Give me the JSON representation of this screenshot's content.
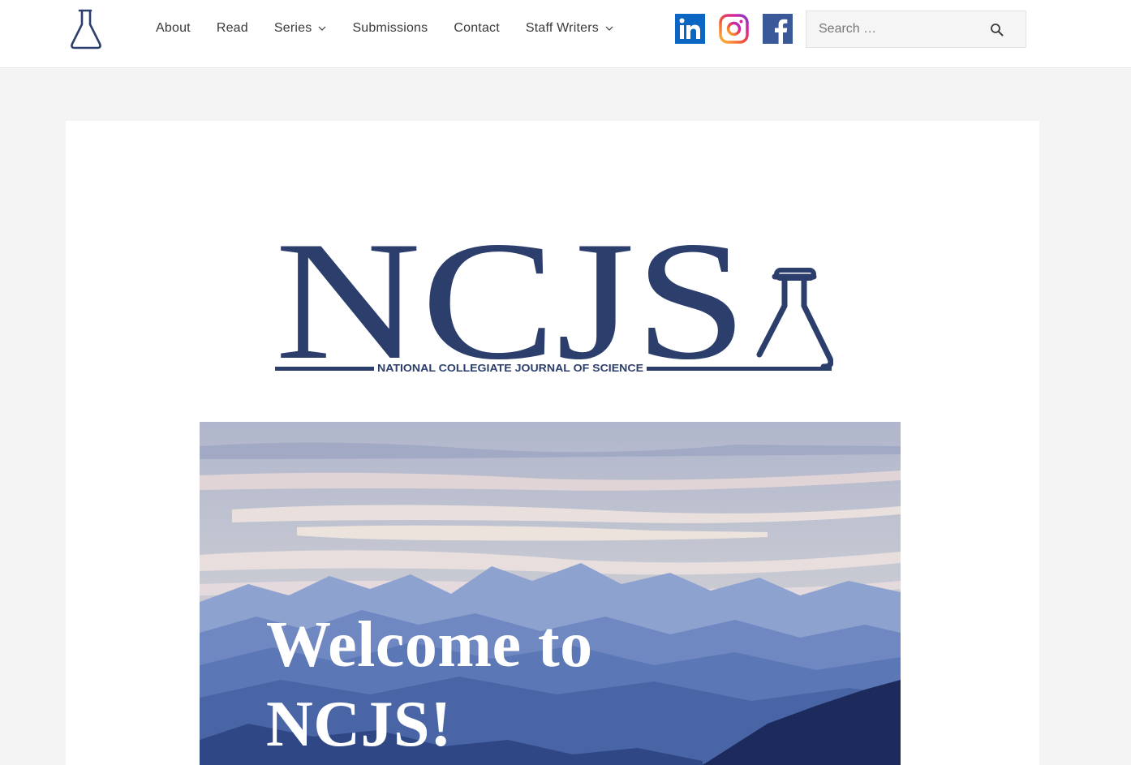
{
  "header": {
    "nav": [
      {
        "label": "About",
        "has_dropdown": false
      },
      {
        "label": "Read",
        "has_dropdown": false
      },
      {
        "label": "Series",
        "has_dropdown": true
      },
      {
        "label": "Submissions",
        "has_dropdown": false
      },
      {
        "label": "Contact",
        "has_dropdown": false
      },
      {
        "label": "Staff Writers",
        "has_dropdown": true
      }
    ],
    "social": [
      {
        "name": "linkedin-icon",
        "color": "#0a66c2"
      },
      {
        "name": "instagram-icon",
        "color": "#e1306c"
      },
      {
        "name": "facebook-icon",
        "color": "#3b5998"
      }
    ],
    "search": {
      "placeholder": "Search …",
      "value": ""
    }
  },
  "logo": {
    "wordmark": "NCJS",
    "subtitle": "NATIONAL COLLEGIATE JOURNAL OF SCIENCE",
    "color": "#2c3e6b"
  },
  "hero": {
    "title_line1": "Welcome to",
    "title_line2": "NCJS!"
  },
  "colors": {
    "page_bg": "#f4f4f4",
    "text": "#3a3a3a",
    "brand": "#2c3e6b"
  }
}
